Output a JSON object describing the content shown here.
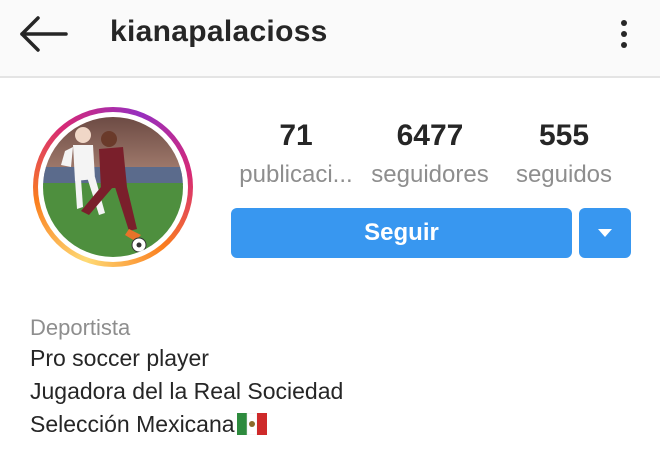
{
  "header": {
    "username": "kianapalacioss",
    "back_icon": "arrow-left-icon",
    "more_icon": "more-vertical-icon"
  },
  "profile": {
    "avatar": "profile-photo",
    "stats": {
      "posts": {
        "count": "71",
        "label": "publicaci..."
      },
      "followers": {
        "count": "6477",
        "label": "seguidores"
      },
      "following": {
        "count": "555",
        "label": "seguidos"
      }
    },
    "follow_button": "Seguir",
    "dropdown_icon": "chevron-down-icon",
    "accent_color": "#3897f0"
  },
  "bio": {
    "category": "Deportista",
    "lines": [
      "Pro soccer player",
      "Jugadora del la Real Sociedad",
      "Selección Mexicana"
    ],
    "flag_icon": "mexico-flag-icon"
  }
}
